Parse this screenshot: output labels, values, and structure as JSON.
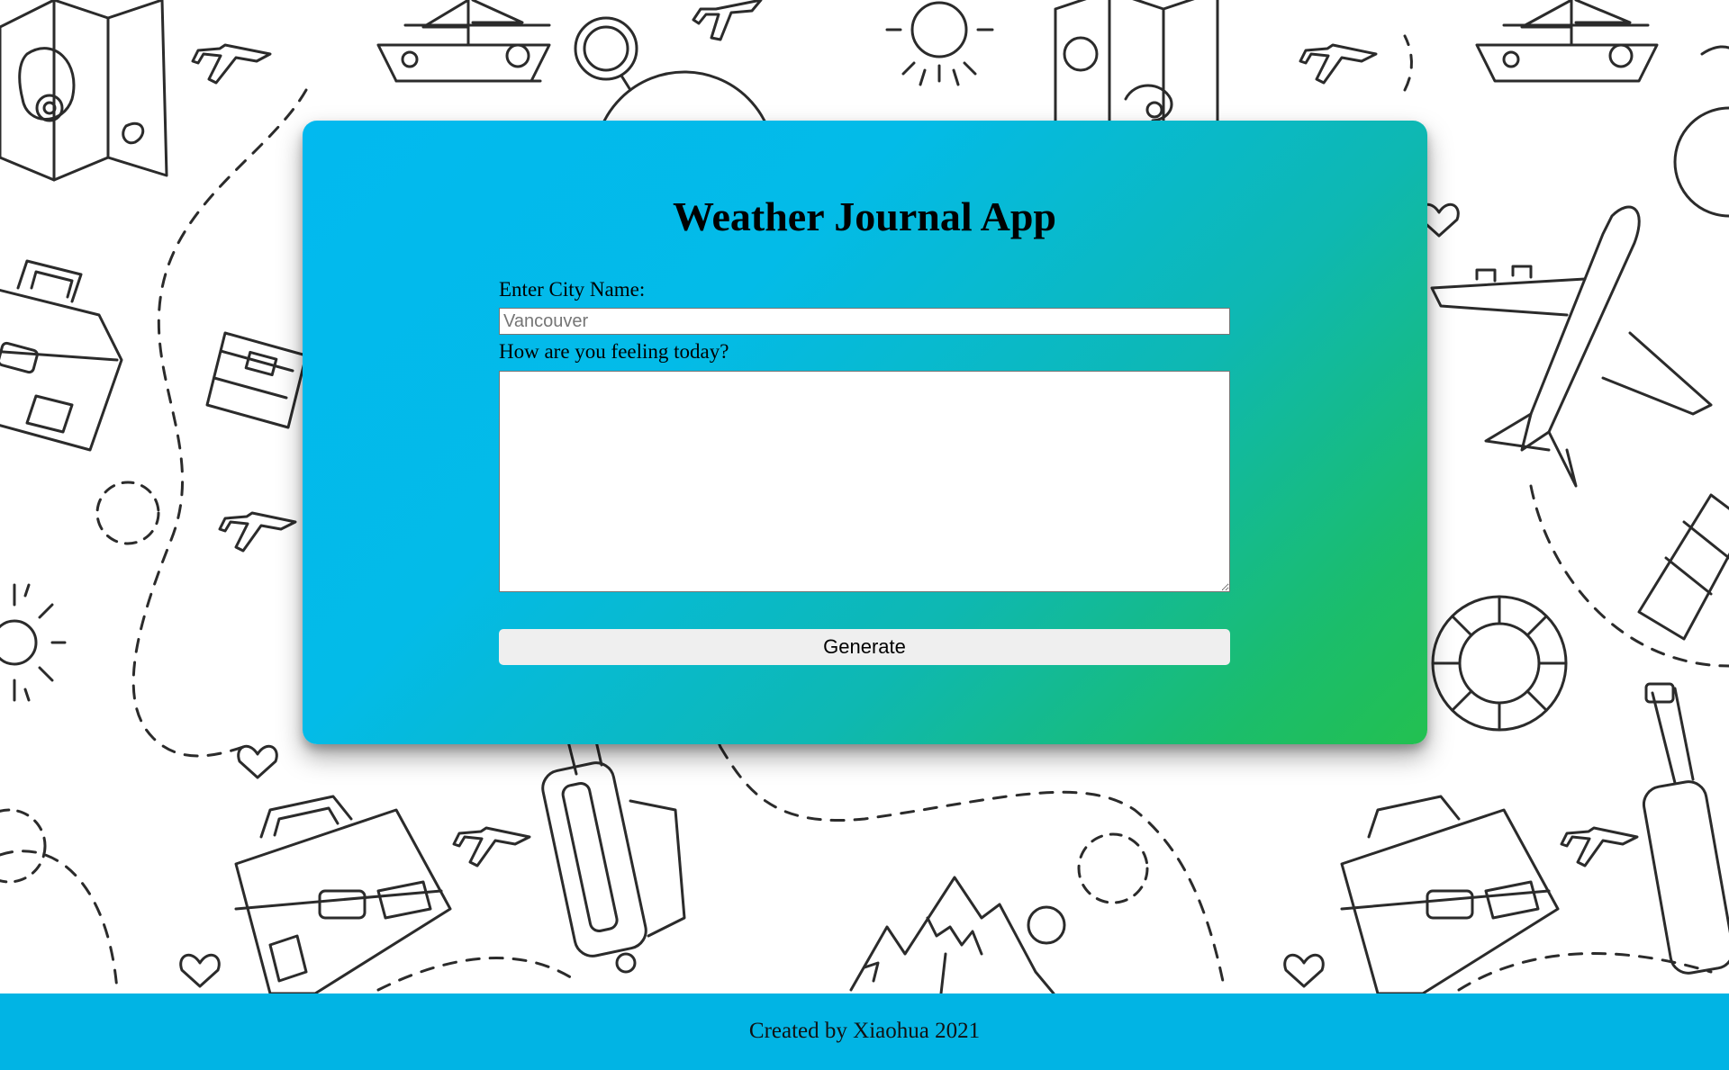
{
  "app": {
    "title": "Weather Journal App"
  },
  "form": {
    "city_label": "Enter City Name:",
    "city_placeholder": "Vancouver",
    "city_value": "",
    "feeling_label": "How are you feeling today?",
    "feeling_value": "",
    "generate_label": "Generate"
  },
  "footer": {
    "text": "Created by Xiaohua 2021"
  },
  "background": {
    "pattern": "travel-doodle-pattern",
    "icons": [
      "map-icon",
      "airplane-icon",
      "sailboat-icon",
      "sun-icon",
      "compass-icon",
      "suitcase-icon",
      "ticket-icon",
      "heart-icon",
      "mountain-icon",
      "rolling-luggage-icon",
      "life-ring-icon"
    ]
  },
  "colors": {
    "card_gradient_start": "#02b9ef",
    "card_gradient_end": "#23c050",
    "footer_bg": "#01b4e4",
    "button_bg": "#efefef"
  }
}
